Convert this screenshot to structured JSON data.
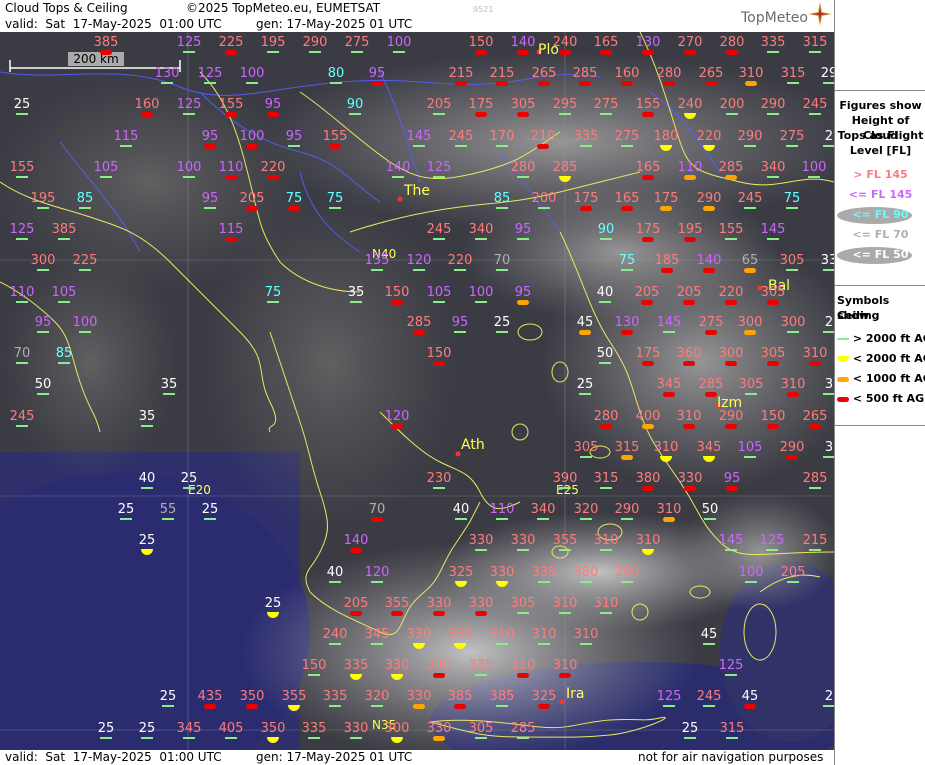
{
  "header": {
    "title": "Cloud Tops & Ceiling",
    "copyright": "©2025 TopMeteo.eu, EUMETSAT",
    "watermark": "9521",
    "valid": "valid:  Sat  17-May-2025  01:00 UTC",
    "generated": "gen: 17-May-2025 01 UTC",
    "logo": "TopMeteo"
  },
  "footer": {
    "valid": "valid:  Sat  17-May-2025  01:00 UTC",
    "generated": "gen: 17-May-2025 01 UTC",
    "disclaimer": "not for air navigation purposes"
  },
  "scale_label": "200 km",
  "legend": {
    "title_lines": [
      "Figures show",
      "Height of Cloud",
      "Tops as Flight",
      "Level  [FL]"
    ],
    "levels": [
      {
        "text": "> FL 145",
        "color": "#ff7c7c",
        "ellipse": false
      },
      {
        "text": "<= FL 145",
        "color": "#cc66ff",
        "ellipse": false
      },
      {
        "text": "<= FL 90",
        "color": "#66ffff",
        "ellipse": true
      },
      {
        "text": "<= FL 70",
        "color": "#b0b0b0",
        "ellipse": false
      },
      {
        "text": "<= FL 50",
        "color": "#ffffff",
        "ellipse": true
      }
    ],
    "symbols_title": [
      "Symbols show",
      "Ceiling"
    ],
    "symbols": [
      {
        "text": "> 2000 ft AGL",
        "kind": "line",
        "color": "#88ee88"
      },
      {
        "text": "< 2000 ft AGL",
        "kind": "half",
        "color": "#ffff00"
      },
      {
        "text": "< 1000 ft AGL",
        "kind": "bar",
        "color": "#ffa500"
      },
      {
        "text": "< 500 ft AGL",
        "kind": "bar",
        "color": "#ee0000"
      }
    ]
  },
  "cities": [
    {
      "name": "Plo"
    },
    {
      "name": "The"
    },
    {
      "name": "Ath"
    },
    {
      "name": "Izm"
    },
    {
      "name": "Bal"
    },
    {
      "name": "Ira"
    }
  ],
  "coords": [
    {
      "name": "N40"
    },
    {
      "name": "E20"
    },
    {
      "name": "E25"
    },
    {
      "name": "N35"
    }
  ],
  "colors": {
    "fl_gt145": "#ff7c7c",
    "fl_le145": "#cc66ff",
    "fl_le90": "#66ffff",
    "fl_le70": "#b0b0b0",
    "fl_le50": "#ffffff",
    "ceil_gt2000": "#88ee88",
    "ceil_lt2000": "#ffff00",
    "ceil_lt1000": "#ffa500",
    "ceil_lt500": "#ee0000"
  },
  "map_labels": [
    [
      106,
      42,
      "385",
      "r"
    ],
    [
      189,
      42,
      "125",
      "g"
    ],
    [
      231,
      42,
      "225",
      "r"
    ],
    [
      273,
      42,
      "195",
      "g"
    ],
    [
      315,
      42,
      "290",
      "g"
    ],
    [
      357,
      42,
      "275",
      "g"
    ],
    [
      399,
      42,
      "100",
      "g"
    ],
    [
      481,
      42,
      "150",
      "r"
    ],
    [
      523,
      42,
      "140",
      "r"
    ],
    [
      565,
      42,
      "240",
      "r"
    ],
    [
      606,
      42,
      "165",
      "r"
    ],
    [
      648,
      42,
      "130",
      "r"
    ],
    [
      690,
      42,
      "270",
      "r"
    ],
    [
      732,
      42,
      "280",
      "r"
    ],
    [
      773,
      42,
      "335",
      "g"
    ],
    [
      815,
      42,
      "315",
      "g"
    ],
    [
      167,
      73,
      "130",
      "g"
    ],
    [
      210,
      73,
      "125",
      "g"
    ],
    [
      252,
      73,
      "100",
      "g"
    ],
    [
      336,
      73,
      "80",
      "g"
    ],
    [
      377,
      73,
      "95",
      "r"
    ],
    [
      461,
      73,
      "215",
      "r"
    ],
    [
      502,
      73,
      "215",
      "r"
    ],
    [
      544,
      73,
      "265",
      "r"
    ],
    [
      585,
      73,
      "285",
      "r"
    ],
    [
      627,
      73,
      "160",
      "r"
    ],
    [
      669,
      73,
      "280",
      "r"
    ],
    [
      711,
      73,
      "265",
      "r"
    ],
    [
      751,
      73,
      "310",
      "o"
    ],
    [
      793,
      73,
      "315",
      "g"
    ],
    [
      829,
      73,
      "29",
      "g"
    ],
    [
      22,
      104,
      "25",
      "g"
    ],
    [
      147,
      104,
      "160",
      "r"
    ],
    [
      189,
      104,
      "125",
      "g"
    ],
    [
      231,
      104,
      "155",
      "r"
    ],
    [
      273,
      104,
      "95",
      "r"
    ],
    [
      355,
      104,
      "90",
      "g"
    ],
    [
      439,
      104,
      "205",
      "g"
    ],
    [
      481,
      104,
      "175",
      "r"
    ],
    [
      523,
      104,
      "305",
      "r"
    ],
    [
      565,
      104,
      "295",
      "g"
    ],
    [
      606,
      104,
      "275",
      "g"
    ],
    [
      648,
      104,
      "155",
      "r"
    ],
    [
      690,
      104,
      "240",
      "y"
    ],
    [
      732,
      104,
      "200",
      "g"
    ],
    [
      773,
      104,
      "290",
      "g"
    ],
    [
      815,
      104,
      "245",
      "g"
    ],
    [
      126,
      136,
      "115",
      "g"
    ],
    [
      210,
      136,
      "95",
      "r"
    ],
    [
      252,
      136,
      "100",
      "r"
    ],
    [
      294,
      136,
      "95",
      "g"
    ],
    [
      335,
      136,
      "155",
      "r"
    ],
    [
      419,
      136,
      "145",
      "g"
    ],
    [
      461,
      136,
      "245",
      "g"
    ],
    [
      502,
      136,
      "170",
      "g"
    ],
    [
      543,
      136,
      "210",
      "r"
    ],
    [
      586,
      136,
      "335",
      "g"
    ],
    [
      627,
      136,
      "275",
      "g"
    ],
    [
      666,
      136,
      "180",
      "y"
    ],
    [
      709,
      136,
      "220",
      "y"
    ],
    [
      750,
      136,
      "290",
      "g"
    ],
    [
      792,
      136,
      "275",
      "g"
    ],
    [
      829,
      136,
      "2",
      "g"
    ],
    [
      22,
      167,
      "155",
      "g"
    ],
    [
      106,
      167,
      "105",
      "g"
    ],
    [
      189,
      167,
      "100",
      "g"
    ],
    [
      231,
      167,
      "110",
      "r"
    ],
    [
      273,
      167,
      "220",
      "r"
    ],
    [
      398,
      167,
      "140",
      "g"
    ],
    [
      439,
      167,
      "125",
      "g"
    ],
    [
      523,
      167,
      "280",
      "g"
    ],
    [
      565,
      167,
      "285",
      "y"
    ],
    [
      648,
      167,
      "165",
      "r"
    ],
    [
      690,
      167,
      "110",
      "o"
    ],
    [
      731,
      167,
      "285",
      "o"
    ],
    [
      773,
      167,
      "340",
      "g"
    ],
    [
      814,
      167,
      "100",
      "g"
    ],
    [
      43,
      198,
      "195",
      "g"
    ],
    [
      85,
      198,
      "85",
      "g"
    ],
    [
      210,
      198,
      "95",
      "g"
    ],
    [
      252,
      198,
      "205",
      "r"
    ],
    [
      294,
      198,
      "75",
      "r"
    ],
    [
      335,
      198,
      "75",
      "g"
    ],
    [
      502,
      198,
      "85",
      "g"
    ],
    [
      544,
      198,
      "200",
      "g"
    ],
    [
      586,
      198,
      "175",
      "r"
    ],
    [
      627,
      198,
      "165",
      "r"
    ],
    [
      666,
      198,
      "175",
      "o"
    ],
    [
      709,
      198,
      "290",
      "o"
    ],
    [
      750,
      198,
      "245",
      "g"
    ],
    [
      792,
      198,
      "75",
      "g"
    ],
    [
      22,
      229,
      "125",
      "g"
    ],
    [
      64,
      229,
      "385",
      "g"
    ],
    [
      231,
      229,
      "115",
      "r"
    ],
    [
      439,
      229,
      "245",
      "g"
    ],
    [
      481,
      229,
      "340",
      "g"
    ],
    [
      523,
      229,
      "95",
      "g"
    ],
    [
      606,
      229,
      "90",
      "g"
    ],
    [
      648,
      229,
      "175",
      "r"
    ],
    [
      690,
      229,
      "195",
      "r"
    ],
    [
      731,
      229,
      "155",
      "g"
    ],
    [
      773,
      229,
      "145",
      "g"
    ],
    [
      43,
      260,
      "300",
      "g"
    ],
    [
      85,
      260,
      "225",
      "g"
    ],
    [
      377,
      260,
      "135",
      "g"
    ],
    [
      419,
      260,
      "120",
      "g"
    ],
    [
      460,
      260,
      "220",
      "g"
    ],
    [
      502,
      260,
      "70",
      "g"
    ],
    [
      627,
      260,
      "75",
      "g"
    ],
    [
      667,
      260,
      "185",
      "r"
    ],
    [
      709,
      260,
      "140",
      "r"
    ],
    [
      750,
      260,
      "65",
      "o"
    ],
    [
      792,
      260,
      "305",
      "g"
    ],
    [
      829,
      260,
      "33",
      "g"
    ],
    [
      22,
      292,
      "110",
      "g"
    ],
    [
      64,
      292,
      "105",
      "g"
    ],
    [
      273,
      292,
      "75",
      "g"
    ],
    [
      356,
      292,
      "35",
      "g"
    ],
    [
      397,
      292,
      "150",
      "r"
    ],
    [
      439,
      292,
      "105",
      "g"
    ],
    [
      481,
      292,
      "100",
      "g"
    ],
    [
      523,
      292,
      "95",
      "o"
    ],
    [
      605,
      292,
      "40",
      "g"
    ],
    [
      647,
      292,
      "205",
      "r"
    ],
    [
      689,
      292,
      "205",
      "r"
    ],
    [
      731,
      292,
      "220",
      "r"
    ],
    [
      773,
      292,
      "305",
      "r"
    ],
    [
      43,
      322,
      "95",
      "g"
    ],
    [
      85,
      322,
      "100",
      "g"
    ],
    [
      419,
      322,
      "285",
      "r"
    ],
    [
      460,
      322,
      "95",
      "g"
    ],
    [
      502,
      322,
      "25",
      "g"
    ],
    [
      585,
      322,
      "45",
      "o"
    ],
    [
      627,
      322,
      "130",
      "r"
    ],
    [
      669,
      322,
      "145",
      "g"
    ],
    [
      711,
      322,
      "275",
      "r"
    ],
    [
      750,
      322,
      "300",
      "o"
    ],
    [
      793,
      322,
      "300",
      "g"
    ],
    [
      829,
      322,
      "2",
      "g"
    ],
    [
      22,
      353,
      "70",
      "g"
    ],
    [
      64,
      353,
      "85",
      "g"
    ],
    [
      439,
      353,
      "150",
      "r"
    ],
    [
      605,
      353,
      "50",
      "g"
    ],
    [
      648,
      353,
      "175",
      "r"
    ],
    [
      689,
      353,
      "360",
      "r"
    ],
    [
      731,
      353,
      "300",
      "r"
    ],
    [
      773,
      353,
      "305",
      "r"
    ],
    [
      815,
      353,
      "310",
      "r"
    ],
    [
      43,
      384,
      "50",
      "g"
    ],
    [
      169,
      384,
      "35",
      "g"
    ],
    [
      585,
      384,
      "25",
      "g"
    ],
    [
      669,
      384,
      "345",
      "r"
    ],
    [
      711,
      384,
      "285",
      "r"
    ],
    [
      751,
      384,
      "305",
      "g"
    ],
    [
      793,
      384,
      "310",
      "r"
    ],
    [
      829,
      384,
      "3",
      "g"
    ],
    [
      22,
      416,
      "245",
      "g"
    ],
    [
      147,
      416,
      "35",
      "g"
    ],
    [
      397,
      416,
      "120",
      "r"
    ],
    [
      606,
      416,
      "280",
      "r"
    ],
    [
      648,
      416,
      "400",
      "o"
    ],
    [
      689,
      416,
      "310",
      "r"
    ],
    [
      731,
      416,
      "290",
      "r"
    ],
    [
      773,
      416,
      "150",
      "r"
    ],
    [
      815,
      416,
      "265",
      "r"
    ],
    [
      586,
      447,
      "305",
      "g"
    ],
    [
      627,
      447,
      "315",
      "o"
    ],
    [
      666,
      447,
      "310",
      "y"
    ],
    [
      709,
      447,
      "345",
      "y"
    ],
    [
      750,
      447,
      "105",
      "g"
    ],
    [
      792,
      447,
      "290",
      "r"
    ],
    [
      829,
      447,
      "3",
      "g"
    ],
    [
      439,
      478,
      "230",
      "g"
    ],
    [
      565,
      478,
      "390",
      "g"
    ],
    [
      606,
      478,
      "315",
      "g"
    ],
    [
      648,
      478,
      "380",
      "r"
    ],
    [
      690,
      478,
      "330",
      "r"
    ],
    [
      732,
      478,
      "95",
      "r"
    ],
    [
      815,
      478,
      "285",
      "g"
    ],
    [
      147,
      478,
      "40",
      "g"
    ],
    [
      189,
      478,
      "25",
      "g"
    ],
    [
      126,
      509,
      "25",
      "g"
    ],
    [
      168,
      509,
      "55",
      "g"
    ],
    [
      210,
      509,
      "25",
      "g"
    ],
    [
      377,
      509,
      "70",
      "r"
    ],
    [
      461,
      509,
      "40",
      "g"
    ],
    [
      502,
      509,
      "110",
      "g"
    ],
    [
      543,
      509,
      "340",
      "g"
    ],
    [
      586,
      509,
      "320",
      "g"
    ],
    [
      627,
      509,
      "290",
      "g"
    ],
    [
      669,
      509,
      "310",
      "o"
    ],
    [
      710,
      509,
      "50",
      "g"
    ],
    [
      147,
      540,
      "25",
      "y"
    ],
    [
      356,
      540,
      "140",
      "r"
    ],
    [
      481,
      540,
      "330",
      "g"
    ],
    [
      523,
      540,
      "330",
      "g"
    ],
    [
      565,
      540,
      "355",
      "g"
    ],
    [
      606,
      540,
      "310",
      "g"
    ],
    [
      648,
      540,
      "310",
      "y"
    ],
    [
      731,
      540,
      "145",
      "g"
    ],
    [
      772,
      540,
      "125",
      "g"
    ],
    [
      815,
      540,
      "215",
      "g"
    ],
    [
      335,
      572,
      "40",
      "g"
    ],
    [
      377,
      572,
      "120",
      "g"
    ],
    [
      461,
      572,
      "325",
      "y"
    ],
    [
      502,
      572,
      "330",
      "y"
    ],
    [
      544,
      572,
      "335",
      "g"
    ],
    [
      586,
      572,
      "380",
      "g"
    ],
    [
      627,
      572,
      "290",
      "g"
    ],
    [
      751,
      572,
      "100",
      "g"
    ],
    [
      793,
      572,
      "205",
      "g"
    ],
    [
      273,
      603,
      "25",
      "y"
    ],
    [
      356,
      603,
      "205",
      "r"
    ],
    [
      397,
      603,
      "355",
      "r"
    ],
    [
      439,
      603,
      "330",
      "r"
    ],
    [
      481,
      603,
      "330",
      "r"
    ],
    [
      523,
      603,
      "305",
      "g"
    ],
    [
      565,
      603,
      "310",
      "g"
    ],
    [
      606,
      603,
      "310",
      "g"
    ],
    [
      335,
      634,
      "240",
      "g"
    ],
    [
      377,
      634,
      "345",
      "g"
    ],
    [
      419,
      634,
      "330",
      "y"
    ],
    [
      460,
      634,
      "330",
      "y"
    ],
    [
      502,
      634,
      "310",
      "g"
    ],
    [
      544,
      634,
      "310",
      "g"
    ],
    [
      586,
      634,
      "310",
      "g"
    ],
    [
      709,
      634,
      "45",
      "g"
    ],
    [
      314,
      665,
      "150",
      "g"
    ],
    [
      356,
      665,
      "335",
      "y"
    ],
    [
      397,
      665,
      "330",
      "y"
    ],
    [
      439,
      665,
      "330",
      "r"
    ],
    [
      481,
      665,
      "335",
      "g"
    ],
    [
      523,
      665,
      "310",
      "r"
    ],
    [
      565,
      665,
      "310",
      "r"
    ],
    [
      731,
      665,
      "125",
      "g"
    ],
    [
      168,
      696,
      "25",
      "g"
    ],
    [
      210,
      696,
      "435",
      "r"
    ],
    [
      252,
      696,
      "350",
      "r"
    ],
    [
      294,
      696,
      "355",
      "y"
    ],
    [
      335,
      696,
      "335",
      "g"
    ],
    [
      377,
      696,
      "320",
      "g"
    ],
    [
      419,
      696,
      "330",
      "o"
    ],
    [
      460,
      696,
      "385",
      "r"
    ],
    [
      502,
      696,
      "385",
      "g"
    ],
    [
      544,
      696,
      "325",
      "r"
    ],
    [
      669,
      696,
      "125",
      "g"
    ],
    [
      709,
      696,
      "245",
      "g"
    ],
    [
      750,
      696,
      "45",
      "r"
    ],
    [
      829,
      696,
      "2",
      "g"
    ],
    [
      106,
      728,
      "25",
      "g"
    ],
    [
      147,
      728,
      "25",
      "g"
    ],
    [
      189,
      728,
      "345",
      "g"
    ],
    [
      231,
      728,
      "405",
      "g"
    ],
    [
      273,
      728,
      "350",
      "y"
    ],
    [
      314,
      728,
      "335",
      "g"
    ],
    [
      356,
      728,
      "330",
      "g"
    ],
    [
      397,
      728,
      "300",
      "y"
    ],
    [
      439,
      728,
      "330",
      "o"
    ],
    [
      481,
      728,
      "305",
      "g"
    ],
    [
      523,
      728,
      "285",
      "g"
    ],
    [
      690,
      728,
      "25",
      "g"
    ],
    [
      732,
      728,
      "315",
      "g"
    ]
  ]
}
